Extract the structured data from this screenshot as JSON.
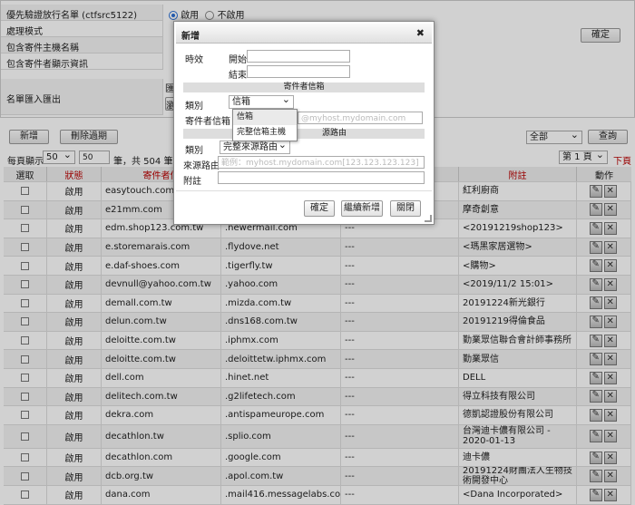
{
  "config": {
    "rows": [
      {
        "label": "優先驗證放行名單 (ctfsrc5122)",
        "radio_on": "啟用",
        "radio_off": "不啟用"
      },
      {
        "label": "處理模式"
      },
      {
        "label": "包含寄件主機名稱"
      },
      {
        "label": "包含寄件者顯示資訊"
      }
    ],
    "import_label": "名單匯入匯出",
    "import_stub": "匯",
    "import_btn_stub": "瀏",
    "confirm": "確定"
  },
  "toolbar": {
    "add": "新增",
    "delete_expired": "刪除過期",
    "filter": "全部",
    "query": "查詢",
    "per_page_label": "每頁顯示",
    "per_page_value": "50",
    "per_page_input": "50",
    "total": "筆，共 504 筆",
    "page": "第 1 頁",
    "next": "下頁"
  },
  "table": {
    "headers": [
      "選取",
      "狀態",
      "寄件者信",
      "",
      "",
      "附註",
      "動作"
    ],
    "rows": [
      {
        "status": "啟用",
        "sender": "easytouch.com.t",
        "route": "",
        "x": "",
        "note": "紅利廚商"
      },
      {
        "status": "啟用",
        "sender": "e21mm.com",
        "route": "",
        "x": "",
        "note": "摩奇創意"
      },
      {
        "status": "啟用",
        "sender": "edm.shop123.com.tw",
        "route": ".newermail.com",
        "x": "---",
        "note": "<20191219shop123>"
      },
      {
        "status": "啟用",
        "sender": "e.storemarais.com",
        "route": ".flydove.net",
        "x": "---",
        "note": "<瑪黑家居選物>"
      },
      {
        "status": "啟用",
        "sender": "e.daf-shoes.com",
        "route": ".tigerfly.tw",
        "x": "---",
        "note": "<購物>"
      },
      {
        "status": "啟用",
        "sender": "devnull@yahoo.com.tw",
        "route": ".yahoo.com",
        "x": "---",
        "note": "<2019/11/2 15:01>"
      },
      {
        "status": "啟用",
        "sender": "demall.com.tw",
        "route": ".mizda.com.tw",
        "x": "---",
        "note": "20191224新光銀行"
      },
      {
        "status": "啟用",
        "sender": "delun.com.tw",
        "route": ".dns168.com.tw",
        "x": "---",
        "note": "20191219得倫食品"
      },
      {
        "status": "啟用",
        "sender": "deloitte.com.tw",
        "route": ".iphmx.com",
        "x": "---",
        "note": "勤業眾信聯合會計師事務所"
      },
      {
        "status": "啟用",
        "sender": "deloitte.com.tw",
        "route": ".deloittetw.iphmx.com",
        "x": "---",
        "note": "勤業眾信"
      },
      {
        "status": "啟用",
        "sender": "dell.com",
        "route": ".hinet.net",
        "x": "---",
        "note": "DELL"
      },
      {
        "status": "啟用",
        "sender": "delitech.com.tw",
        "route": ".g2lifetech.com",
        "x": "---",
        "note": "得立科技有限公司"
      },
      {
        "status": "啟用",
        "sender": "dekra.com",
        "route": ".antispameurope.com",
        "x": "---",
        "note": "德凱認證股份有限公司"
      },
      {
        "status": "啟用",
        "sender": "decathlon.tw",
        "route": ".splio.com",
        "x": "---",
        "note": "台灣迪卡儂有限公司 - 2020-01-13"
      },
      {
        "status": "啟用",
        "sender": "decathlon.com",
        "route": ".google.com",
        "x": "---",
        "note": "迪卡儂"
      },
      {
        "status": "啟用",
        "sender": "dcb.org.tw",
        "route": ".apol.com.tw",
        "x": "---",
        "note": "20191224財團法人生物技術開發中心"
      },
      {
        "status": "啟用",
        "sender": "dana.com",
        "route": ".mail416.messagelabs.com",
        "x": "---",
        "note": "<Dana Incorporated>"
      }
    ]
  },
  "dialog": {
    "title": "新增",
    "close": "✖",
    "effective_label": "時效",
    "start_label": "開始",
    "end_label": "結束",
    "sender_section": "寄件者信箱",
    "type_label": "類別",
    "type_value": "信箱",
    "sender_label": "寄件者信箱",
    "sender_placeholder": "@myhost.mydomain.com",
    "route_section": "源路由",
    "route_type_label": "類別",
    "route_type_value": "完整來源路由",
    "route_label": "來源路由",
    "route_placeholder": "範例：myhost.mydomain.com[123.123.123.123]",
    "note_label": "附註",
    "ok": "確定",
    "continue": "繼續新增",
    "close_btn": "關閉",
    "dropdown_options": [
      "信箱",
      "完整信箱主機"
    ]
  }
}
